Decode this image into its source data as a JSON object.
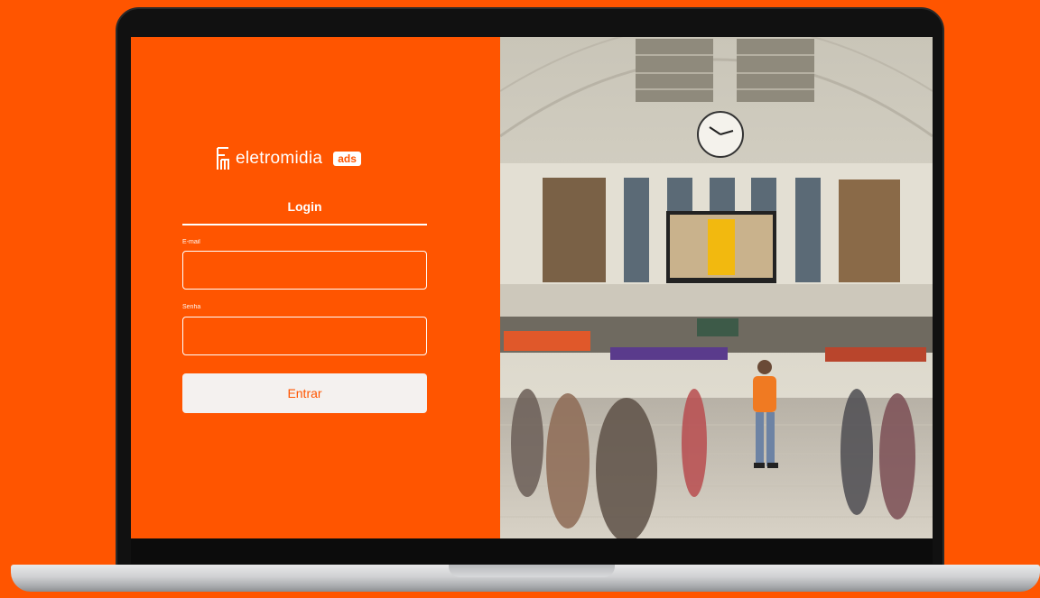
{
  "brand": {
    "name": "eletromidia",
    "badge": "ads"
  },
  "login": {
    "tab_label": "Login",
    "email_label": "E-mail",
    "email_value": "",
    "password_label": "Senha",
    "password_value": "",
    "submit_label": "Entrar"
  },
  "colors": {
    "accent": "#ff5500",
    "button_bg": "#f4f1ef"
  },
  "icons": [
    "eletromidia-logo-icon"
  ]
}
